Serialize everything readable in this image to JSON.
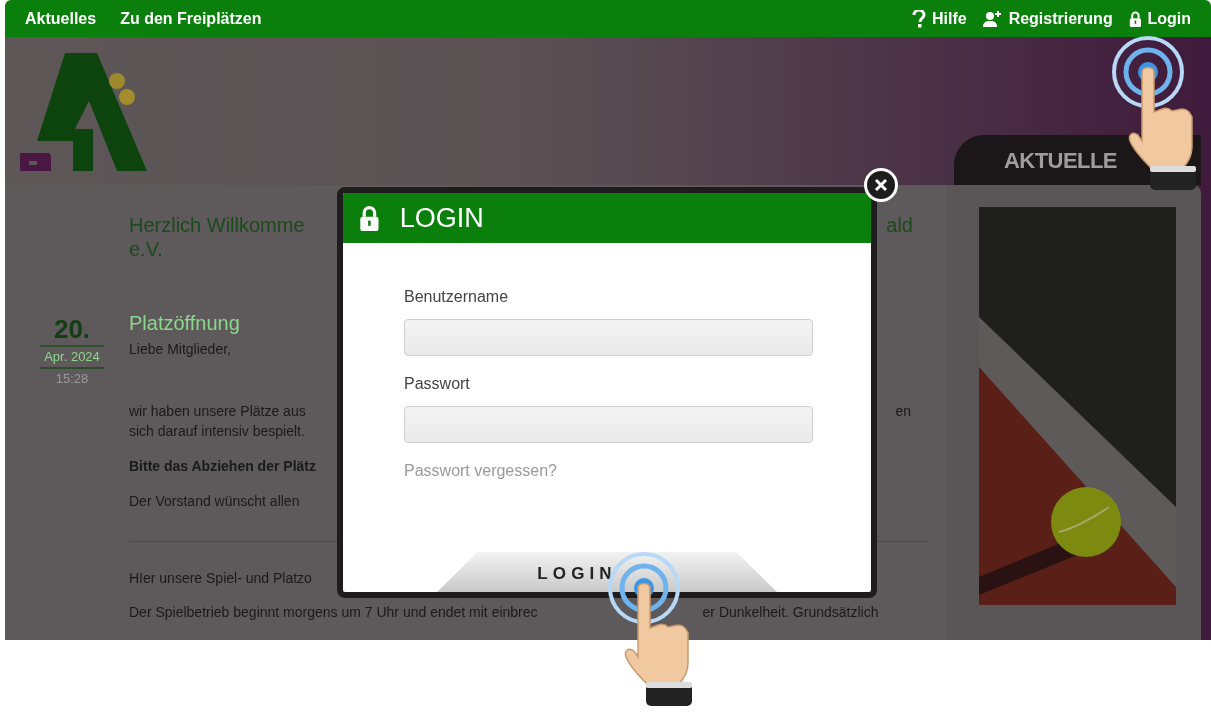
{
  "nav": {
    "left": [
      {
        "label": "Aktuelles"
      },
      {
        "label": "Zu den Freiplätzen"
      }
    ],
    "right": [
      {
        "kind": "help",
        "label": "Hilfe"
      },
      {
        "kind": "register",
        "label": "Registrierung"
      },
      {
        "kind": "lock",
        "label": "Login"
      }
    ]
  },
  "welcome": {
    "line1": [
      "Herzlich Willkomme",
      "ald"
    ],
    "line2": "e.V."
  },
  "post": {
    "date": {
      "day": "20.",
      "month": "Apr. 2024",
      "time": "15:28"
    },
    "title": "Platzöffnung",
    "paragraphs": [
      {
        "kind": "text",
        "parts": [
          "Liebe Mitglieder,"
        ]
      },
      {
        "kind": "text",
        "parts": [
          "wir haben unsere Plätze aus",
          "en"
        ]
      },
      {
        "kind": "text",
        "parts": [
          "sich darauf intensiv bespielt."
        ]
      },
      {
        "kind": "bold",
        "parts": [
          "Bitte das Abziehen der Plätz"
        ]
      },
      {
        "kind": "text",
        "parts": [
          "Der Vorstand wünscht allen"
        ]
      }
    ]
  },
  "section": [
    {
      "parts": [
        "HIer unsere Spiel- und Platzo"
      ]
    },
    {
      "parts": [
        "Der Spielbetrieb beginnt morgens um 7 Uhr und endet mit einbrec",
        "er Dunkelheit. Grundsätzlich"
      ]
    }
  ],
  "sidebar": {
    "tab": "AKTUELLE"
  },
  "modal": {
    "title": "LOGIN",
    "fields": [
      {
        "label": "Benutzername"
      },
      {
        "label": "Passwort"
      }
    ],
    "forgot": "Passwort vergessen?",
    "button": "LOGIN"
  }
}
